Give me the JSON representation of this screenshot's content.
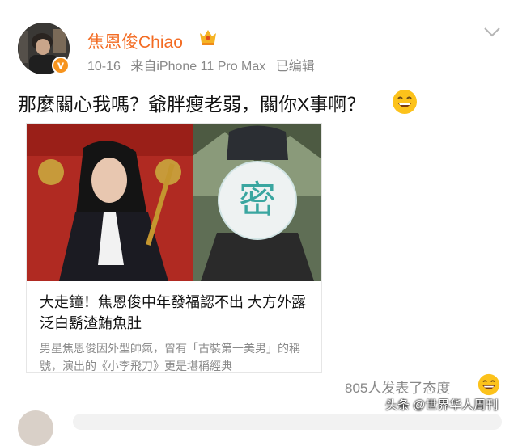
{
  "post": {
    "username": "焦恩俊Chiao",
    "date": "10-16",
    "source": "来自iPhone 11 Pro Max",
    "edited": "已编辑",
    "text": "那麼關心我嗎？爺胖瘦老弱，關你X事啊？",
    "avatar_badge": "v",
    "icons": [
      "vip-crown-icon",
      "chevron-down-icon",
      "laughing-emoji-icon"
    ]
  },
  "card": {
    "title": "大走鐘！焦恩俊中年發福認不出 大方外露泛白鬍渣鮪魚肚",
    "summary": "男星焦恩俊因外型帥氣，曾有「古裝第一美男」的稱號，演出的《小李飛刀》更是堪稱經典",
    "mosaic_char": "密"
  },
  "footer": {
    "reactions": "805人发表了态度",
    "watermark": "头条 @世界华人周刊"
  },
  "colors": {
    "username": "#f36b22",
    "meta": "#888888",
    "badge": "#f7941e"
  }
}
